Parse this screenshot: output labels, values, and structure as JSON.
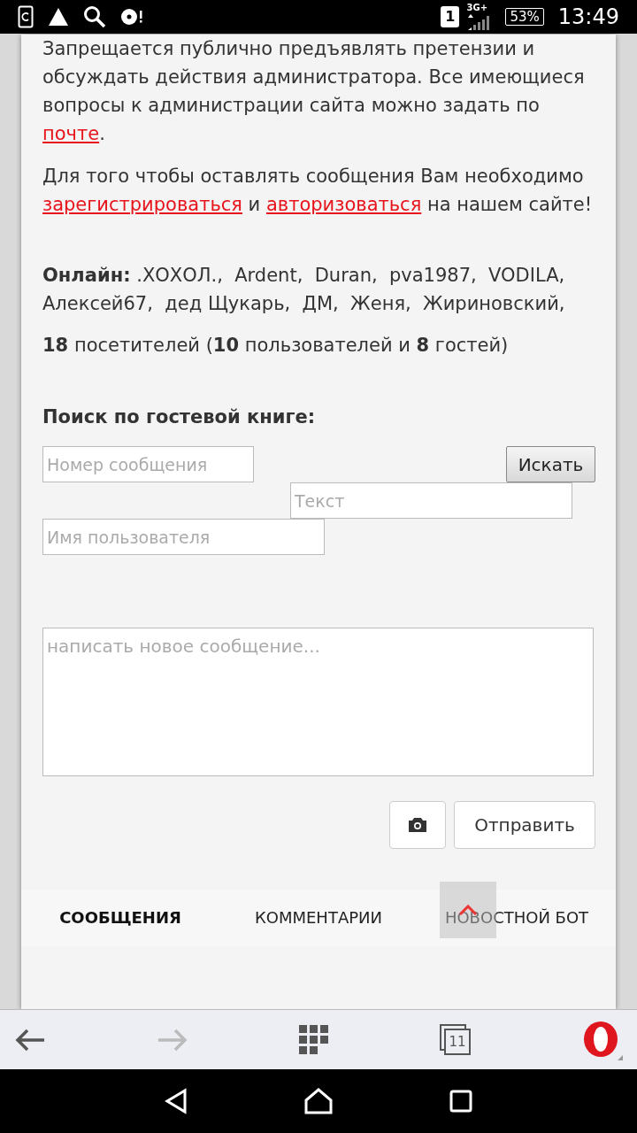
{
  "status_bar": {
    "sim": "1",
    "network": "3G+",
    "battery": "53%",
    "time": "13:49"
  },
  "rules": [
    {
      "parts": [
        {
          "text": "Запрещается публично предъявлять претензии и обсуждать действия администратора. Все имеющиеся вопросы к администрации сайта можно задать по ",
          "kind": "text"
        },
        {
          "text": "почте",
          "kind": "link"
        },
        {
          "text": ".",
          "kind": "text"
        }
      ]
    },
    {
      "parts": [
        {
          "text": "Для того чтобы оставлять сообщения Вам необходимо ",
          "kind": "text"
        },
        {
          "text": "зарегистрироваться",
          "kind": "link"
        },
        {
          "text": " и ",
          "kind": "text"
        },
        {
          "text": "авторизоваться",
          "kind": "link"
        },
        {
          "text": " на нашем сайте!",
          "kind": "text"
        }
      ]
    }
  ],
  "online": "**Онлайн:** .ХОХОЛ.,  Ardent,  Duran,  pva1987,  VODILA,  Алексей67,  дед Щукарь,  ДМ,  Женя,  Жириновский,",
  "visitors": "**18** посетителей (**10** пользователей и **8** гостей)",
  "search": {
    "title": "Поиск по гостевой книге:",
    "number_placeholder": "Номер сообщения",
    "text_placeholder": "Текст",
    "user_placeholder": "Имя пользователя",
    "button": "Искать"
  },
  "compose": {
    "placeholder": "написать новое сообщение...",
    "send": "Отправить"
  },
  "tabs": [
    {
      "label": "СООБЩЕНИЯ",
      "selected": true
    },
    {
      "label": "КОММЕНТАРИИ",
      "selected": false
    },
    {
      "label": "НОВОСТНОЙ БОТ",
      "selected": false
    }
  ],
  "browser_bar": {
    "tab_count": "11"
  }
}
